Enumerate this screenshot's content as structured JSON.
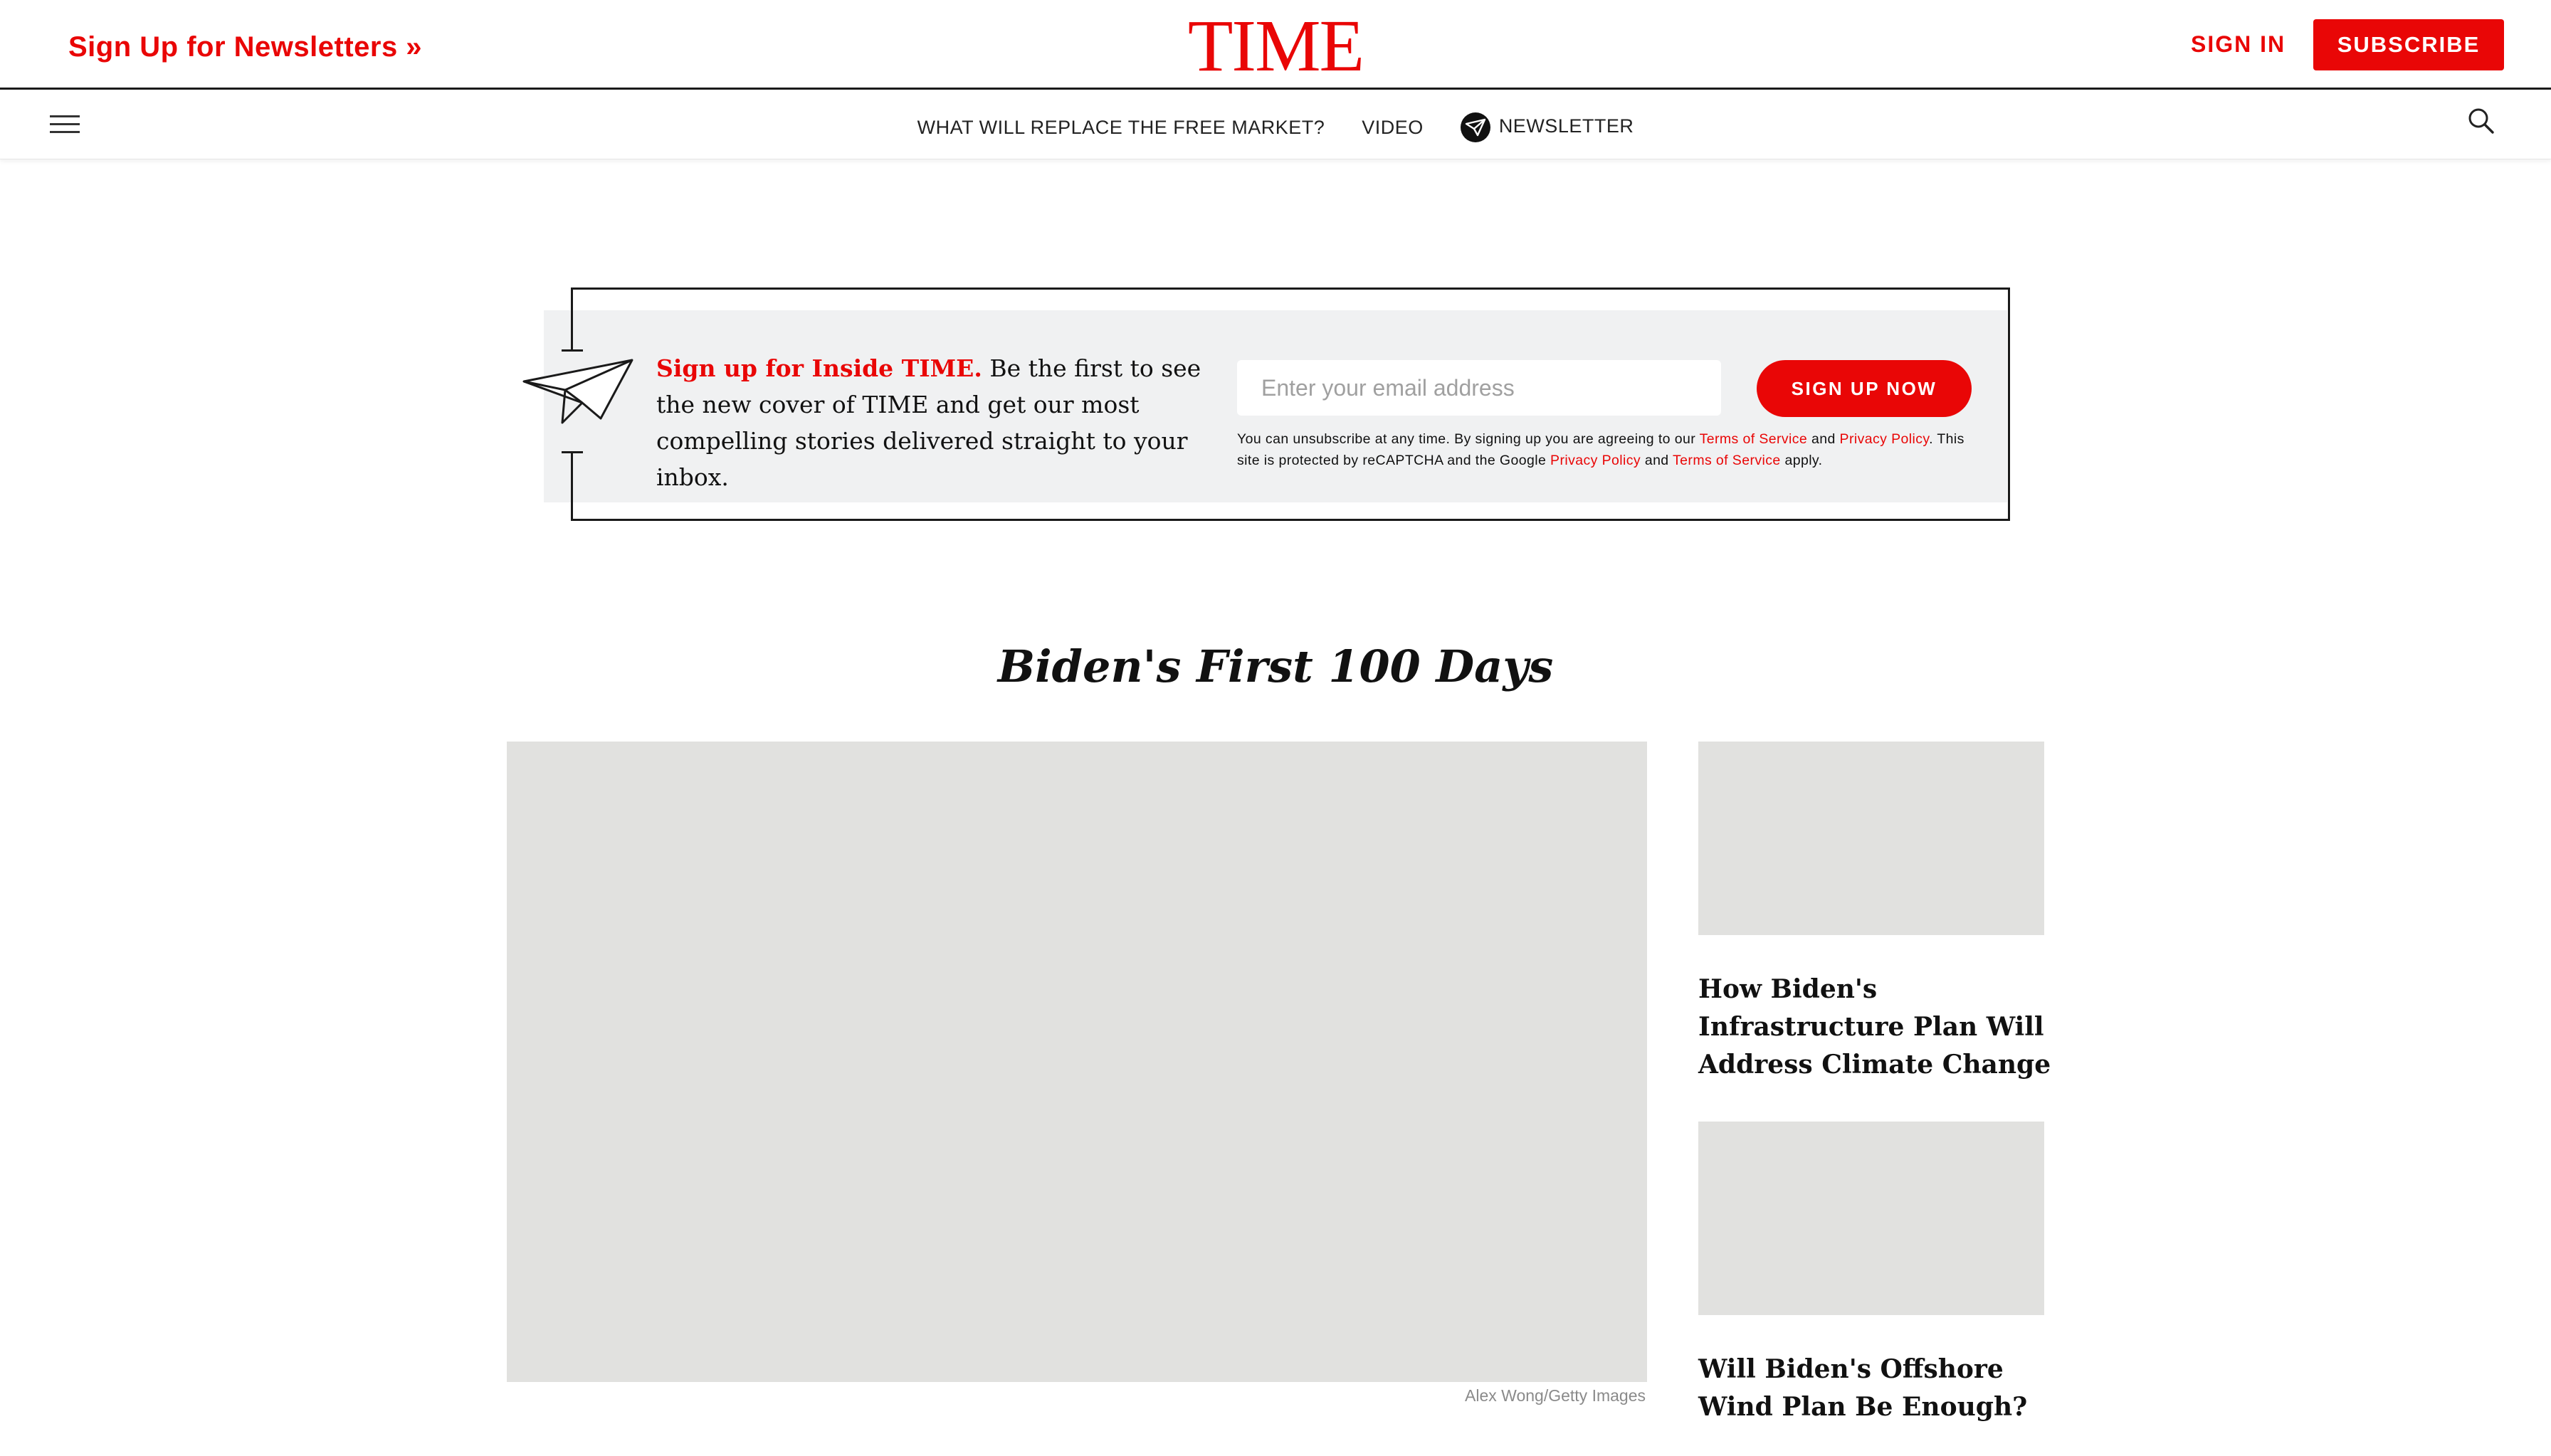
{
  "header": {
    "newsletters_link": "Sign Up for Newsletters »",
    "logo": "TIME",
    "sign_in": "SIGN IN",
    "subscribe": "SUBSCRIBE"
  },
  "nav": {
    "menu_icon": "hamburger-menu-icon",
    "items": [
      {
        "label": "WHAT WILL REPLACE THE FREE MARKET?"
      },
      {
        "label": "VIDEO"
      },
      {
        "label": "NEWSLETTER",
        "icon": "paper-plane-icon"
      }
    ],
    "search_icon": "search-icon"
  },
  "newsletter_signup": {
    "highlight": "Sign up for Inside TIME.",
    "body": " Be the first to see the new cover of TIME and get our most compelling stories delivered straight to your inbox.",
    "email_placeholder": "Enter your email address",
    "button": "SIGN UP NOW",
    "legal": {
      "part1": "You can unsubscribe at any time. By signing up you are agreeing to our ",
      "tos1": "Terms of Service",
      "and1": " and ",
      "privacy1": "Privacy Policy",
      "part2": ". This site is protected by reCAPTCHA and the Google ",
      "privacy2": "Privacy Policy",
      "and2": " and ",
      "tos2": "Terms of Service",
      "part3": " apply."
    }
  },
  "section": {
    "title": "Biden's First 100 Days",
    "hero_credit": "Alex Wong/Getty Images",
    "side_stories": [
      {
        "headline": "How Biden's Infrastructure Plan Will Address Climate Change"
      },
      {
        "headline": "Will Biden's Offshore Wind Plan Be Enough?"
      }
    ]
  },
  "colors": {
    "brand_red": "#e90606",
    "placeholder_gray": "#e1e1df",
    "module_bg": "#f0f1f2"
  }
}
